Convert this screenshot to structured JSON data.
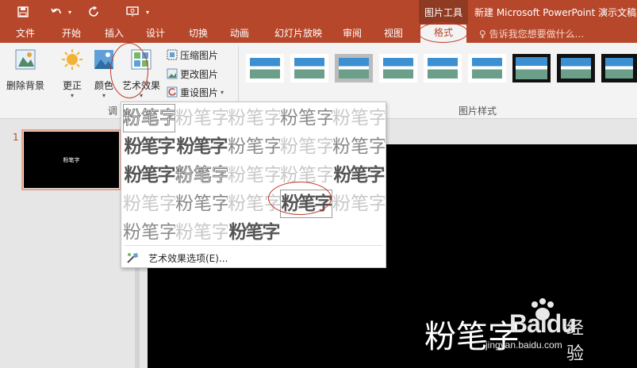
{
  "titlebar": {
    "context_group": "图片工具",
    "doc_title": "新建 Microsoft PowerPoint 演示文稿"
  },
  "qat": {
    "save_icon": "save-icon",
    "undo_icon": "undo-icon",
    "redo_icon": "redo-icon",
    "present_icon": "present-icon"
  },
  "tabs": [
    {
      "label": "文件"
    },
    {
      "label": "开始"
    },
    {
      "label": "插入"
    },
    {
      "label": "设计"
    },
    {
      "label": "切换"
    },
    {
      "label": "动画"
    },
    {
      "label": "幻灯片放映"
    },
    {
      "label": "审阅"
    },
    {
      "label": "视图"
    },
    {
      "label": "格式"
    }
  ],
  "tell_me": "告诉我您想要做什么...",
  "ribbon": {
    "remove_bg": "删除背景",
    "corrections": "更正",
    "color": "颜色",
    "artistic_effects": "艺术效果",
    "compress": "压缩图片",
    "change_picture": "更改图片",
    "reset_picture": "重设图片",
    "group_adjust": "调",
    "group_styles": "图片样式"
  },
  "gallery": {
    "sample_text": "粉笔字",
    "options_label": "艺术效果选项(E)..."
  },
  "thumbnail": {
    "number": "1",
    "text": "粉笔字"
  },
  "slide": {
    "text": "粉笔字"
  },
  "watermark": {
    "brand": "Baidu",
    "suffix": "经验",
    "url": "jingyan.baidu.com"
  },
  "colors": {
    "accent": "#b7472a",
    "annotation": "#c0392b"
  }
}
